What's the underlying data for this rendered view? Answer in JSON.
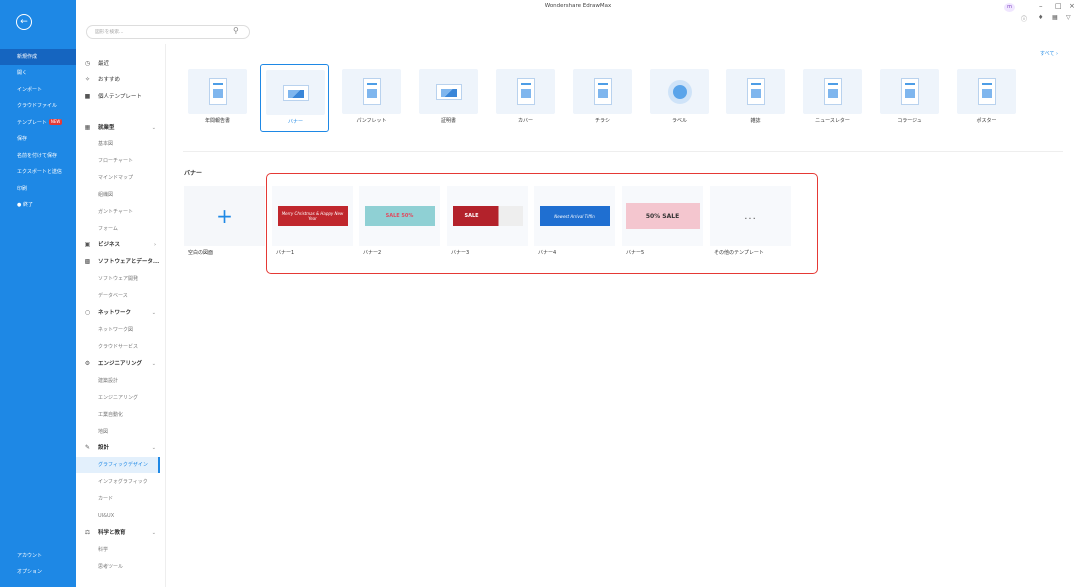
{
  "app": {
    "title": "Wondershare EdrawMax",
    "user_initials": "m"
  },
  "leftbar": {
    "items": [
      {
        "label": "新規作成",
        "active": true
      },
      {
        "label": "開く"
      },
      {
        "label": "インポート"
      },
      {
        "label": "クラウドファイル"
      },
      {
        "label": "テンプレート",
        "badge": "NEW"
      },
      {
        "label": "保存"
      },
      {
        "label": "名前を付けて保存"
      },
      {
        "label": "エクスポートと送信"
      },
      {
        "label": "印刷"
      },
      {
        "label": "終了"
      }
    ],
    "bottom": [
      {
        "label": "アカウント"
      },
      {
        "label": "オプション"
      }
    ]
  },
  "search": {
    "placeholder": "図形を検索..."
  },
  "sidebar": {
    "top": [
      {
        "label": "最近",
        "icon": "clock-icon"
      },
      {
        "label": "おすすめ",
        "icon": "star-icon"
      },
      {
        "label": "個人テンプレート",
        "icon": "user-template-icon"
      }
    ],
    "groups": [
      {
        "label": "就業型",
        "icon": "grid-icon",
        "children": [
          "基本図",
          "フローチャート",
          "マインドマップ",
          "組織図",
          "ガントチャート",
          "フォーム"
        ]
      },
      {
        "label": "ビジネス",
        "icon": "briefcase-icon",
        "children": []
      },
      {
        "label": "ソフトウェアとデータ...",
        "icon": "software-icon",
        "children": [
          "ソフトウェア開発",
          "データベース"
        ]
      },
      {
        "label": "ネットワーク",
        "icon": "network-icon",
        "children": [
          "ネットワーク図",
          "クラウドサービス"
        ]
      },
      {
        "label": "エンジニアリング",
        "icon": "engineering-icon",
        "children": [
          "建築設計",
          "エンジニアリング",
          "工業自動化",
          "地図"
        ]
      },
      {
        "label": "設計",
        "icon": "design-icon",
        "children": [
          "グラフィックデザイン",
          "インフォグラフィック",
          "カード",
          "UI&UX"
        ],
        "selected": "グラフィックデザイン"
      },
      {
        "label": "科学と教育",
        "icon": "science-icon",
        "children": [
          "科学",
          "思考ツール"
        ]
      }
    ]
  },
  "main": {
    "see_all": "すべて",
    "template_types": [
      {
        "label": "年間報告書",
        "thumb": "doc"
      },
      {
        "label": "バナー",
        "thumb": "pic",
        "selected": true
      },
      {
        "label": "パンフレット",
        "thumb": "doc"
      },
      {
        "label": "証明書",
        "thumb": "pic"
      },
      {
        "label": "カバー",
        "thumb": "doc"
      },
      {
        "label": "チラシ",
        "thumb": "doc"
      },
      {
        "label": "ラベル",
        "thumb": "circ"
      },
      {
        "label": "雑誌",
        "thumb": "doc"
      },
      {
        "label": "ニュースレター",
        "thumb": "doc"
      },
      {
        "label": "コラージュ",
        "thumb": "doc"
      },
      {
        "label": "ポスター",
        "thumb": "doc"
      }
    ],
    "section_title": "バナー",
    "blank_label": "空白の図面",
    "banners": [
      {
        "label": "バナー1",
        "text": "Merry Christmas & Happy New Year",
        "bg": "#c0272d"
      },
      {
        "label": "バナー2",
        "text": "SALE 50%",
        "bg": "#8fd0d4"
      },
      {
        "label": "バナー3",
        "text": "SALE",
        "bg": "#b3222b"
      },
      {
        "label": "バナー4",
        "text": "Newest Arrival Tiffin",
        "bg": "#1f6fd1"
      },
      {
        "label": "バナー5",
        "text": "50% SALE",
        "bg": "#f4c6cf"
      }
    ],
    "more_label": "その他のテンプレート",
    "more_glyph": "..."
  },
  "colors": {
    "accent": "#1e88e5",
    "highlight": "#e53935"
  }
}
